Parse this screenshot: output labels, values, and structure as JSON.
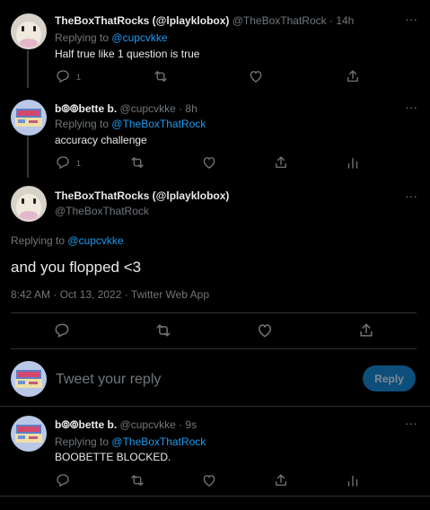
{
  "tweets": [
    {
      "name": "TheBoxThatRocks (@lplayklobox)",
      "handle": "@TheBoxThatRock",
      "time": "· 14h",
      "replying_label": "Replying to",
      "replying_to": "@cupcvkke",
      "text": "Half true like 1 question is true",
      "reply_count": "1"
    },
    {
      "name": "b⦾⦾bette b.",
      "handle": "@cupcvkke",
      "time": "· 8h",
      "replying_label": "Replying to",
      "replying_to": "@TheBoxThatRock",
      "text": "accuracy challenge",
      "reply_count": "1"
    }
  ],
  "focused": {
    "name": "TheBoxThatRocks (@lplayklobox)",
    "handle": "@TheBoxThatRock",
    "replying_label": "Replying to",
    "replying_to": "@cupcvkke",
    "text": "and you flopped <3",
    "timestamp": "8:42 AM · Oct 13, 2022 · Twitter Web App"
  },
  "composer": {
    "placeholder": "Tweet your reply",
    "button_label": "Reply"
  },
  "last_reply": {
    "name": "b⦾⦾bette b.",
    "handle": "@cupcvkke",
    "time": "· 9s",
    "replying_label": "Replying to",
    "replying_to": "@TheBoxThatRock",
    "text": "BOOBETTE BLOCKED."
  },
  "more_icon": "···",
  "colors": {
    "background": "#000000",
    "text": "#e7e9ea",
    "muted": "#71767b",
    "link": "#1d9bf0",
    "reply_button": "#0e4e7a"
  }
}
